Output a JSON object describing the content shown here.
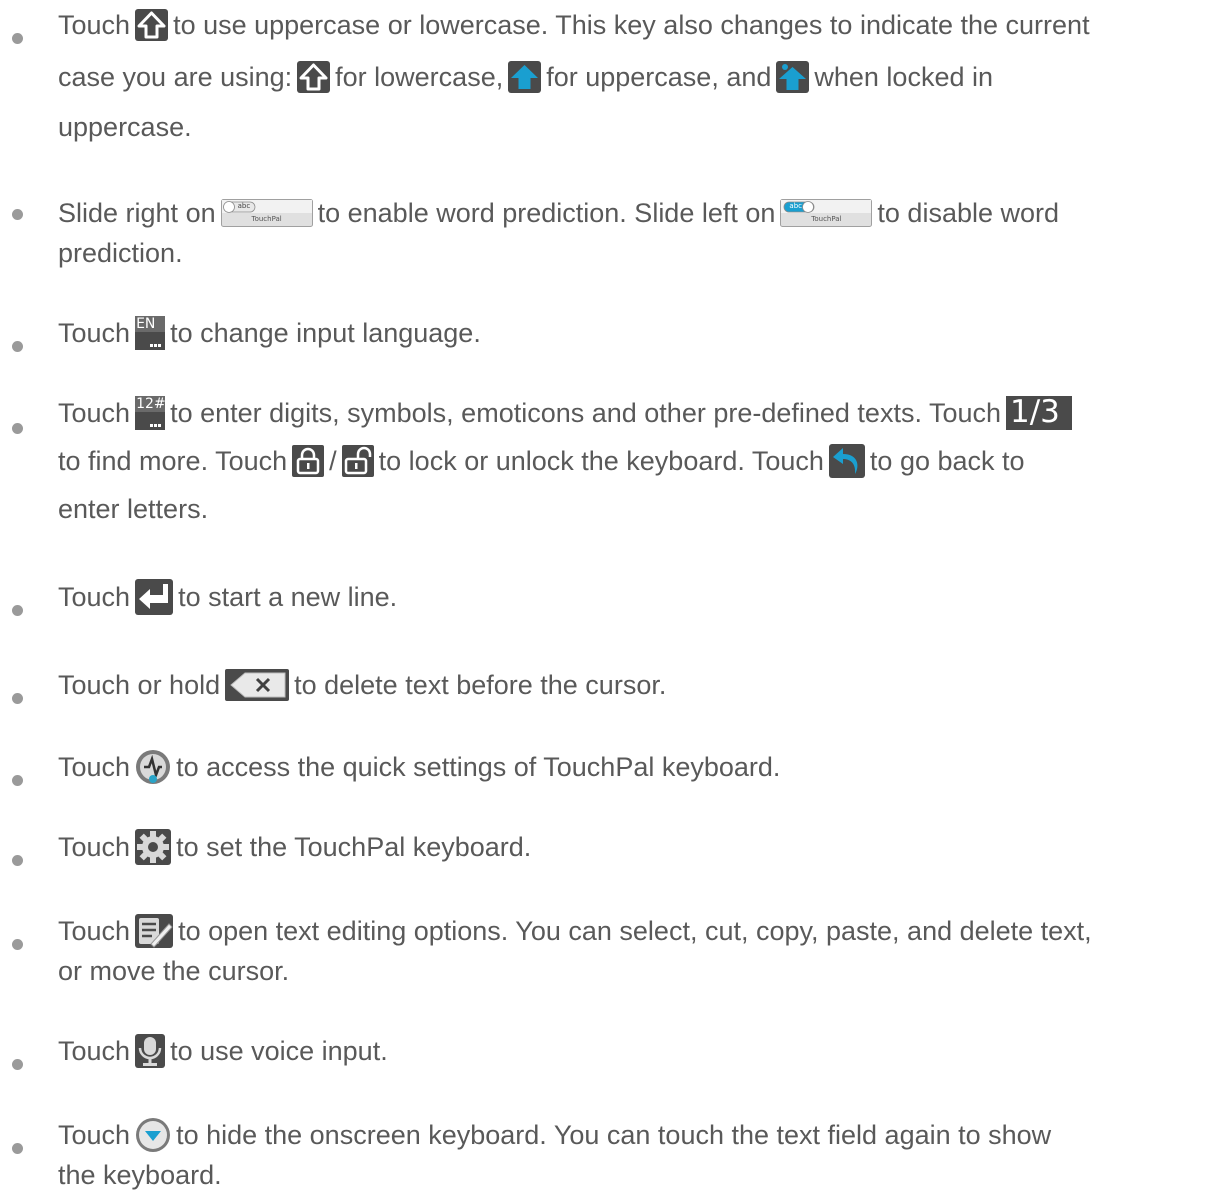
{
  "items": [
    {
      "name": "shift",
      "lines": [
        [
          "Touch",
          {
            "icon": "shift-outline-icon"
          },
          "to use uppercase or lowercase. This key also changes to indicate the current"
        ],
        [
          "case you are using:",
          {
            "icon": "shift-outline-icon"
          },
          "for lowercase,",
          {
            "icon": "shift-filled-icon"
          },
          "for uppercase, and",
          {
            "icon": "shift-locked-icon"
          },
          "when locked in"
        ],
        [
          "uppercase."
        ]
      ]
    },
    {
      "name": "word-prediction",
      "lines": [
        [
          "Slide right on",
          {
            "icon": "touchpal-toggle-off-icon"
          },
          "to enable word prediction. Slide left on",
          {
            "icon": "touchpal-toggle-on-icon"
          },
          "to disable word"
        ],
        [
          "prediction."
        ]
      ]
    },
    {
      "name": "language",
      "lines": [
        [
          "Touch",
          {
            "icon": "language-en-key-icon"
          },
          "to change input language."
        ]
      ]
    },
    {
      "name": "symbols",
      "lines": [
        [
          "Touch",
          {
            "icon": "symbols-key-icon"
          },
          "to enter digits, symbols, emoticons and other pre-defined texts. Touch",
          {
            "icon": "page-one-of-three-icon"
          }
        ],
        [
          "to find more. Touch",
          {
            "icon": "lock-closed-icon"
          },
          "/",
          {
            "icon": "lock-open-icon"
          },
          "to lock or unlock the keyboard. Touch",
          {
            "icon": "back-arrow-icon"
          },
          "to go back to"
        ],
        [
          "enter letters."
        ]
      ]
    },
    {
      "name": "enter",
      "lines": [
        [
          "Touch",
          {
            "icon": "enter-key-icon"
          },
          "to start a new line."
        ]
      ]
    },
    {
      "name": "delete",
      "lines": [
        [
          "Touch or hold",
          {
            "icon": "backspace-key-icon"
          },
          "to delete text before the cursor."
        ]
      ]
    },
    {
      "name": "quick-settings",
      "lines": [
        [
          "Touch",
          {
            "icon": "quick-settings-icon"
          },
          "to access the quick settings of TouchPal keyboard."
        ]
      ]
    },
    {
      "name": "settings",
      "lines": [
        [
          "Touch",
          {
            "icon": "gear-icon"
          },
          "to set the TouchPal keyboard."
        ]
      ]
    },
    {
      "name": "text-editing",
      "lines": [
        [
          "Touch",
          {
            "icon": "text-edit-icon"
          },
          "to open text editing options. You can select, cut, copy, paste, and delete text,"
        ],
        [
          "or move the cursor."
        ]
      ]
    },
    {
      "name": "voice",
      "lines": [
        [
          "Touch",
          {
            "icon": "microphone-icon"
          },
          "to use voice input."
        ]
      ]
    },
    {
      "name": "hide-keyboard",
      "lines": [
        [
          "Touch",
          {
            "icon": "hide-keyboard-icon"
          },
          "to hide the onscreen keyboard. You can touch the text field again to show"
        ],
        [
          "the keyboard."
        ]
      ]
    }
  ],
  "icon_labels": {
    "touchpal": "TouchPal",
    "abc": "abc",
    "en": "EN",
    "ellipsis": "...",
    "symbols": "12#",
    "page": "1/3"
  },
  "colors": {
    "text": "#595959",
    "bullet": "#9a9a9a",
    "key_dark": "#4a4a4a",
    "accent_blue": "#1a9fd0"
  }
}
